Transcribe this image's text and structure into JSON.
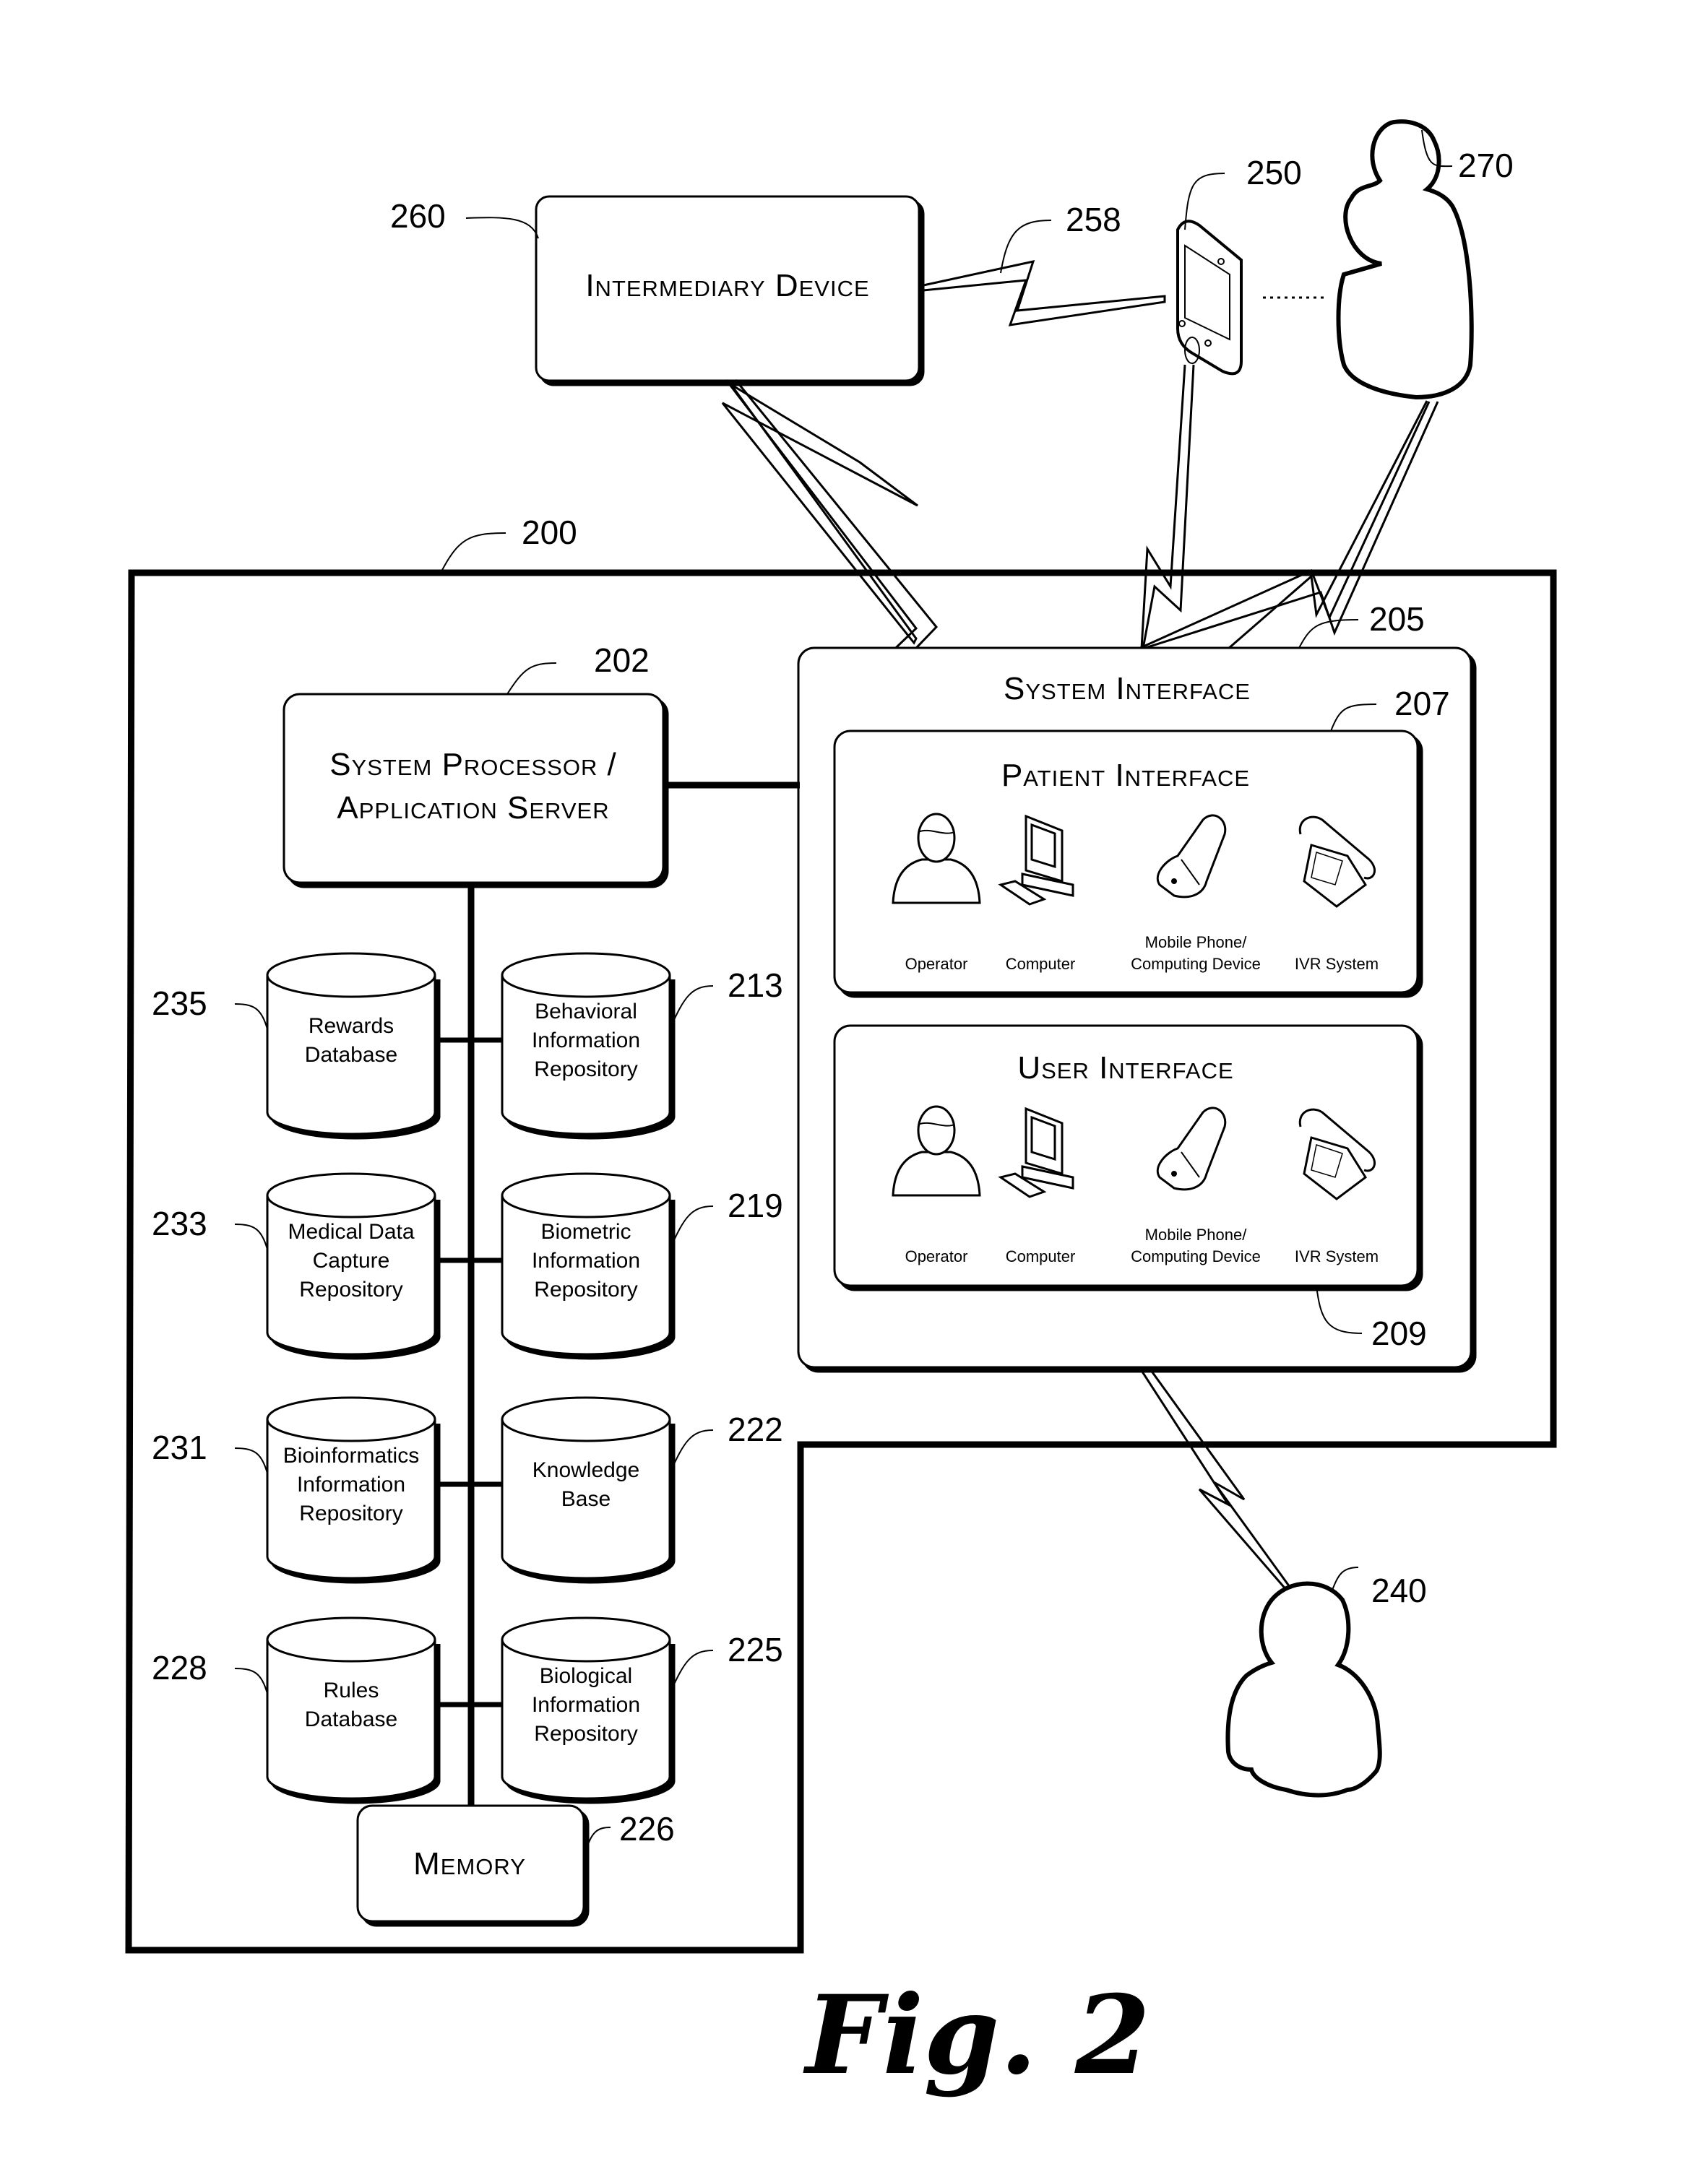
{
  "figure": {
    "caption": "Fig. 2",
    "system_ref": "200"
  },
  "intermediary_device": {
    "ref": "260",
    "label": "Intermediary Device"
  },
  "wireless_link": {
    "ref": "258"
  },
  "mobile_device": {
    "ref": "250"
  },
  "remote_user": {
    "ref": "270"
  },
  "external_user": {
    "ref": "240"
  },
  "processor": {
    "ref": "202",
    "line1": "System Processor /",
    "line2": "Application Server"
  },
  "system_interface": {
    "ref": "205",
    "title": "System Interface",
    "panels": [
      {
        "ref": "207",
        "title": "Patient Interface",
        "devices": [
          {
            "icon": "operator-icon",
            "label": [
              "Operator"
            ]
          },
          {
            "icon": "computer-icon",
            "label": [
              "Computer"
            ]
          },
          {
            "icon": "mobile-phone-icon",
            "label": [
              "Mobile Phone/",
              "Computing Device"
            ]
          },
          {
            "icon": "telephone-icon",
            "label": [
              "IVR System"
            ]
          }
        ]
      },
      {
        "ref": "209",
        "title": "User Interface",
        "devices": [
          {
            "icon": "operator-icon",
            "label": [
              "Operator"
            ]
          },
          {
            "icon": "computer-icon",
            "label": [
              "Computer"
            ]
          },
          {
            "icon": "mobile-phone-icon",
            "label": [
              "Mobile Phone/",
              "Computing Device"
            ]
          },
          {
            "icon": "telephone-icon",
            "label": [
              "IVR System"
            ]
          }
        ]
      }
    ]
  },
  "databases": {
    "left": [
      {
        "ref": "235",
        "lines": [
          "Rewards",
          "Database"
        ]
      },
      {
        "ref": "233",
        "lines": [
          "Medical Data",
          "Capture",
          "Repository"
        ]
      },
      {
        "ref": "231",
        "lines": [
          "Bioinformatics",
          "Information",
          "Repository"
        ]
      },
      {
        "ref": "228",
        "lines": [
          "Rules",
          "Database"
        ]
      }
    ],
    "right": [
      {
        "ref": "213",
        "lines": [
          "Behavioral",
          "Information",
          "Repository"
        ]
      },
      {
        "ref": "219",
        "lines": [
          "Biometric",
          "Information",
          "Repository"
        ]
      },
      {
        "ref": "222",
        "lines": [
          "Knowledge",
          "Base"
        ]
      },
      {
        "ref": "225",
        "lines": [
          "Biological",
          "Information",
          "Repository"
        ]
      }
    ]
  },
  "memory": {
    "ref": "226",
    "label": "Memory"
  }
}
